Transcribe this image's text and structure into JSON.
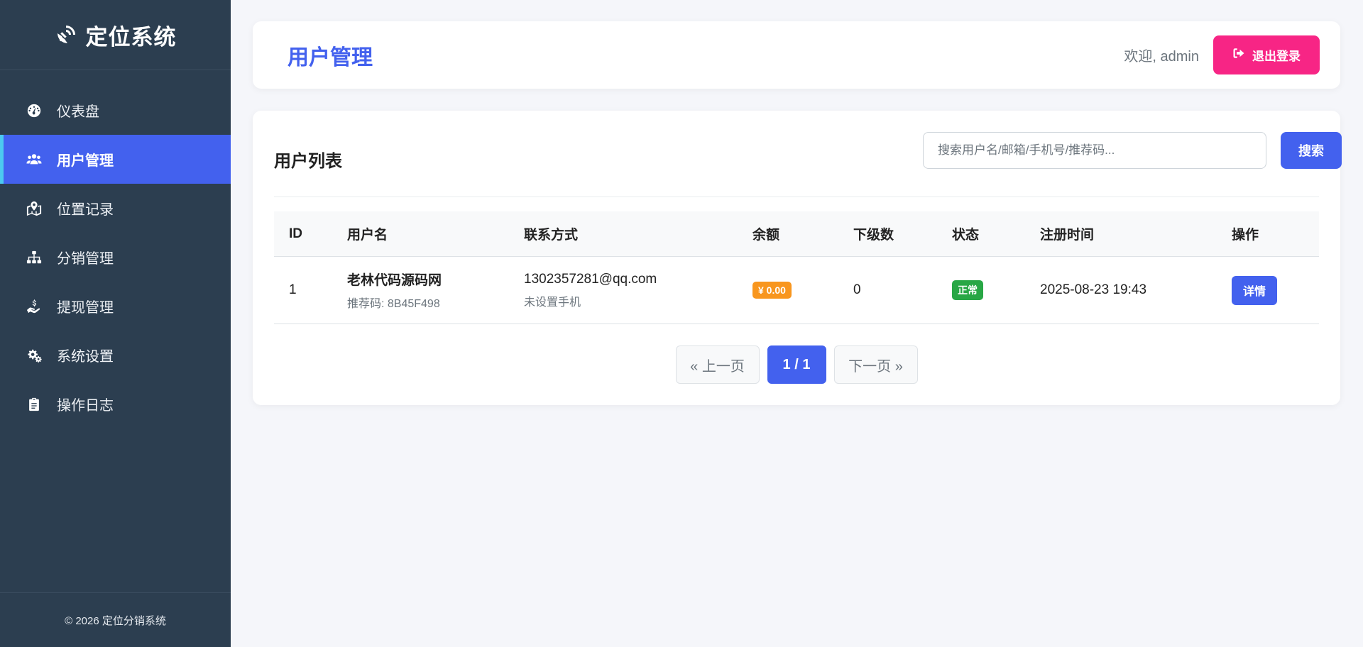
{
  "app": {
    "brand": "定位系统",
    "brand_icon": "satellite-dish-icon",
    "footer": "© 2026 定位分销系统"
  },
  "sidebar": {
    "items": [
      {
        "label": "仪表盘",
        "icon": "tachometer-icon",
        "active": false
      },
      {
        "label": "用户管理",
        "icon": "users-icon",
        "active": true
      },
      {
        "label": "位置记录",
        "icon": "map-marked-icon",
        "active": false
      },
      {
        "label": "分销管理",
        "icon": "sitemap-icon",
        "active": false
      },
      {
        "label": "提现管理",
        "icon": "hand-holding-usd-icon",
        "active": false
      },
      {
        "label": "系统设置",
        "icon": "cogs-icon",
        "active": false
      },
      {
        "label": "操作日志",
        "icon": "clipboard-icon",
        "active": false
      }
    ]
  },
  "header": {
    "title": "用户管理",
    "welcome": "欢迎, admin",
    "logout_label": "退出登录"
  },
  "user_list": {
    "title": "用户列表",
    "search_placeholder": "搜索用户名/邮箱/手机号/推荐码...",
    "search_label": "搜索",
    "columns": [
      "ID",
      "用户名",
      "联系方式",
      "余额",
      "下级数",
      "状态",
      "注册时间",
      "操作"
    ],
    "rows": [
      {
        "id": "1",
        "username": "老林代码源码网",
        "referral": "推荐码: 8B45F498",
        "email": "1302357281@qq.com",
        "phone": "未设置手机",
        "balance": "¥ 0.00",
        "subordinates": "0",
        "status": "正常",
        "registered": "2025-08-23 19:43",
        "action": "详情"
      }
    ]
  },
  "pagination": {
    "prev": "« 上一页",
    "current": "1 / 1",
    "next": "下一页 »"
  },
  "colors": {
    "sidebar_bg": "#2c3e50",
    "primary": "#4361ee",
    "logout": "#f72585",
    "balance_badge": "#f8961e",
    "status_badge": "#28a745"
  }
}
